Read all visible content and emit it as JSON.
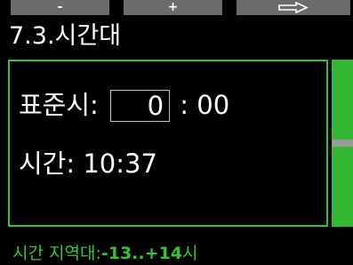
{
  "softkeys": {
    "minus_label": "-",
    "plus_label": "+",
    "next_icon": "right-arrow-icon"
  },
  "screen_title": "7.3.시간대",
  "standard_time": {
    "label": "표준시:",
    "hour_value": "0",
    "minutes_suffix": ": 00"
  },
  "current_time": {
    "label": "시간:",
    "value": "10:37"
  },
  "footer": {
    "label": "시간 지역대:",
    "range": "-13..+14",
    "unit": "시"
  },
  "colors": {
    "accent": "#33c633",
    "softkey": "#6b6b6b",
    "background": "#000000"
  }
}
